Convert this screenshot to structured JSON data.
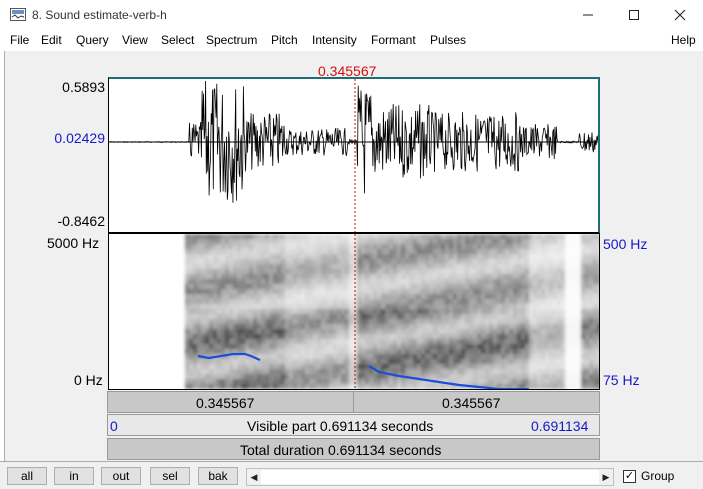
{
  "window": {
    "title": "8. Sound estimate-verb-h"
  },
  "menu": [
    "File",
    "Edit",
    "Query",
    "View",
    "Select",
    "Spectrum",
    "Pitch",
    "Intensity",
    "Formant",
    "Pulses",
    "Help"
  ],
  "cursor": {
    "time": "0.345567"
  },
  "waveform": {
    "max_label": "0.5893",
    "cursor_value": "0.02429",
    "min_label": "-0.8462"
  },
  "spectrogram": {
    "top_freq": "5000 Hz",
    "bottom_freq": "0 Hz",
    "pitch_top": "500 Hz",
    "pitch_bottom": "75 Hz"
  },
  "time_bar": {
    "left_value": "0.345567",
    "right_value": "0.345567"
  },
  "visible_bar": {
    "start": "0",
    "label": "Visible part 0.691134 seconds",
    "end": "0.691134"
  },
  "total_bar": {
    "label": "Total duration 0.691134 seconds"
  },
  "buttons": {
    "all": "all",
    "in": "in",
    "out": "out",
    "sel": "sel",
    "bak": "bak"
  },
  "group": {
    "label": "Group",
    "checked": true
  },
  "colors": {
    "cursor": "#d01010",
    "pitch": "#1a4fd6",
    "axis_blue": "#1818c8",
    "workspace": "#f0f0f0"
  }
}
